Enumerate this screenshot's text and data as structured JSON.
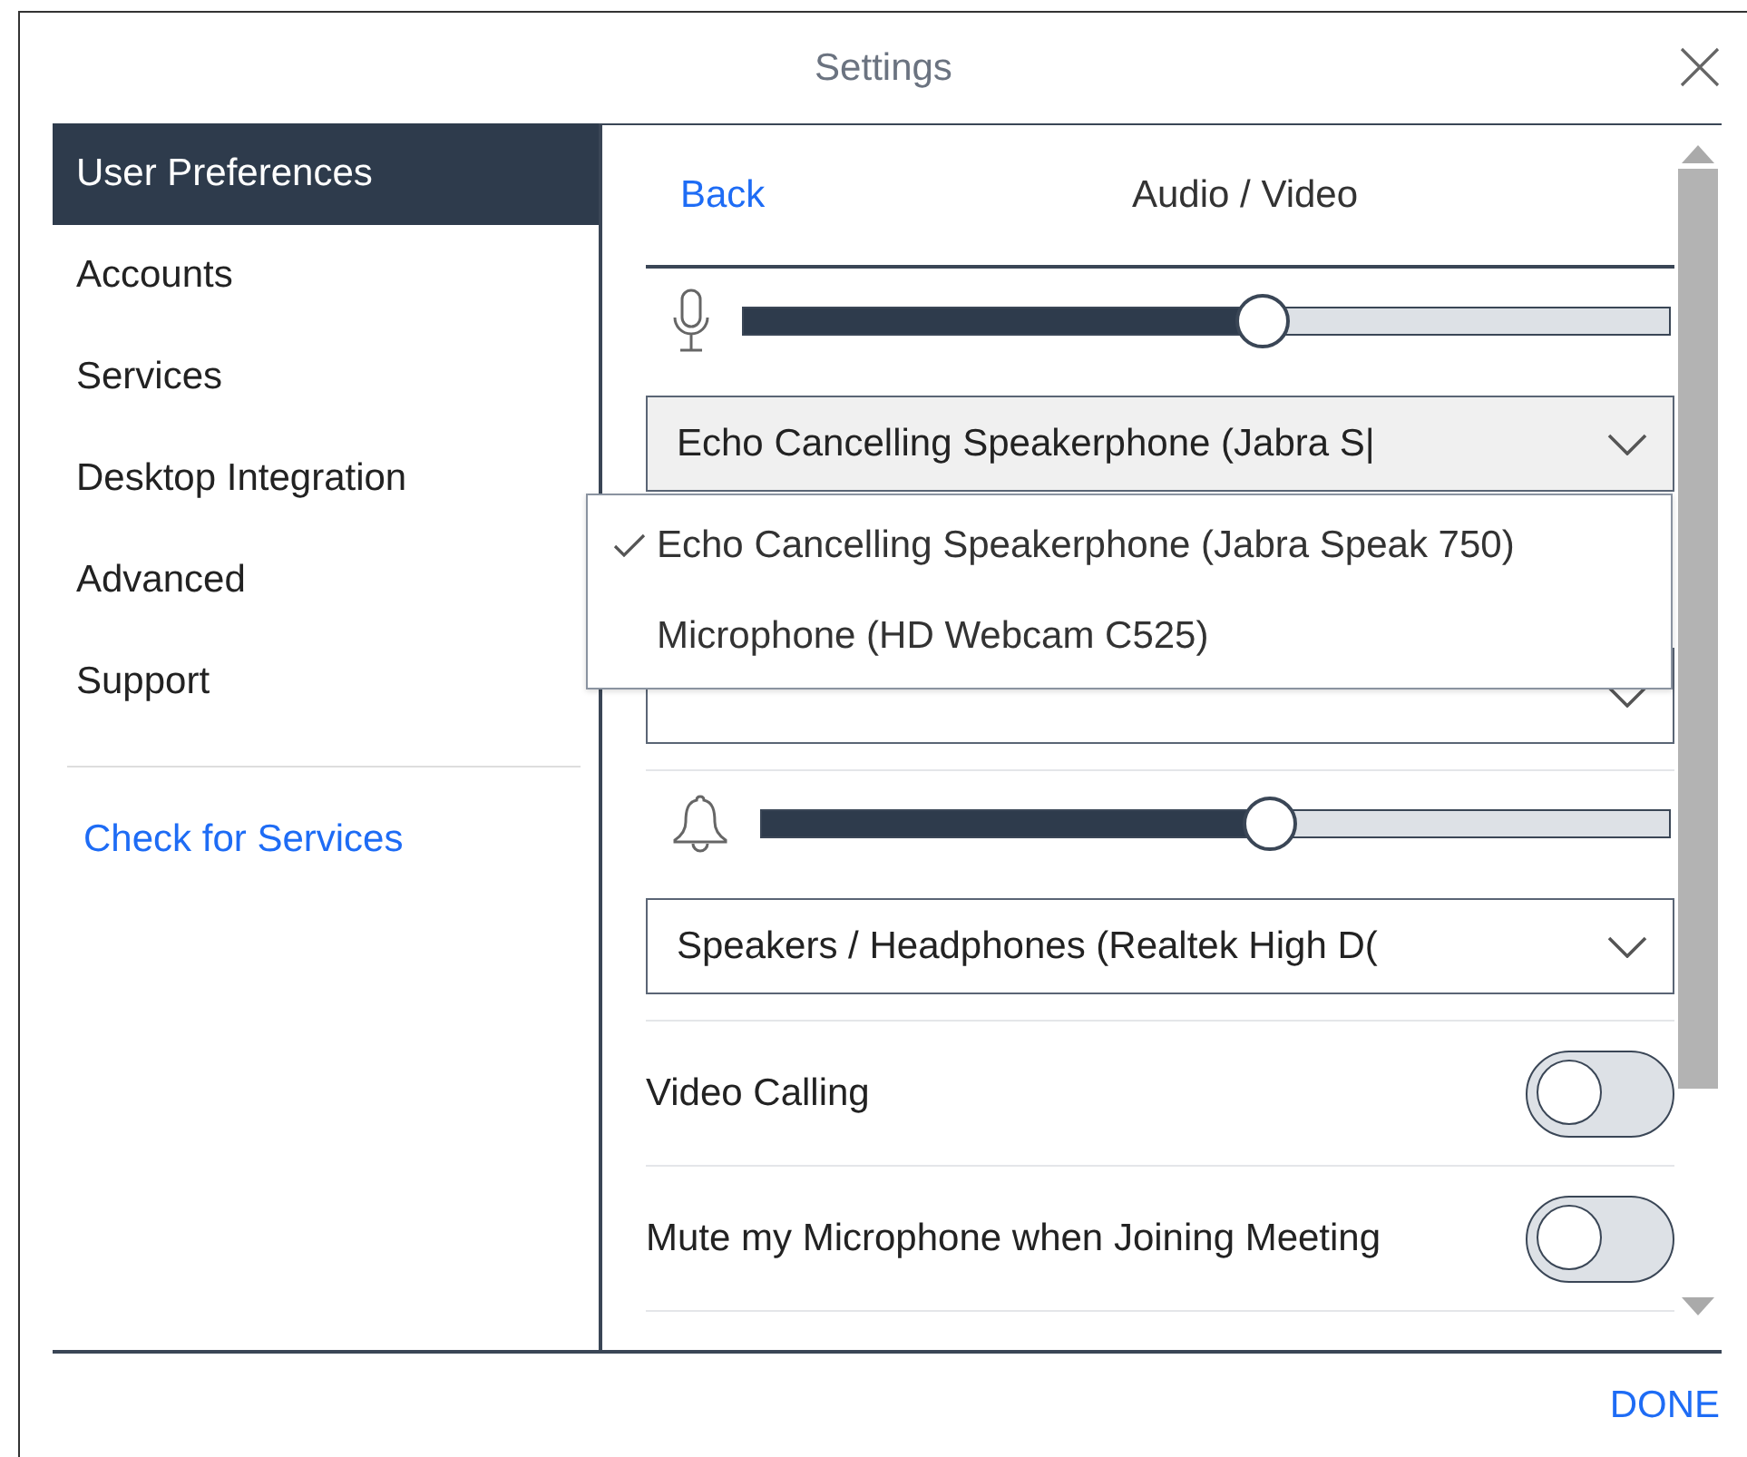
{
  "window": {
    "title": "Settings"
  },
  "sidebar": {
    "items": [
      {
        "label": "User Preferences",
        "selected": true
      },
      {
        "label": "Accounts",
        "selected": false
      },
      {
        "label": "Services",
        "selected": false
      },
      {
        "label": "Desktop Integration",
        "selected": false
      },
      {
        "label": "Advanced",
        "selected": false
      },
      {
        "label": "Support",
        "selected": false
      }
    ],
    "link": "Check for Services"
  },
  "header": {
    "back": "Back",
    "title": "Audio / Video"
  },
  "devices": [
    {
      "kind": "microphone",
      "level": 0.56,
      "selects": [
        {
          "value": "Echo Cancelling Speakerphone (Jabra S|",
          "open": true
        },
        {
          "open": false
        }
      ]
    },
    {
      "kind": "ringer",
      "level": 0.56,
      "selects": [
        {
          "value": "Speakers / Headphones (Realtek High D(",
          "open": false
        }
      ]
    }
  ],
  "menu": {
    "options": [
      {
        "label": "Echo Cancelling Speakerphone (Jabra Speak 750)",
        "selected": true
      },
      {
        "label": "Microphone (HD Webcam C525)",
        "selected": false
      }
    ]
  },
  "toggles": [
    {
      "label": "Video Calling",
      "on": false
    },
    {
      "label": "Mute my Microphone when Joining Meeting",
      "on": false
    }
  ],
  "footer": {
    "done": "DONE"
  }
}
